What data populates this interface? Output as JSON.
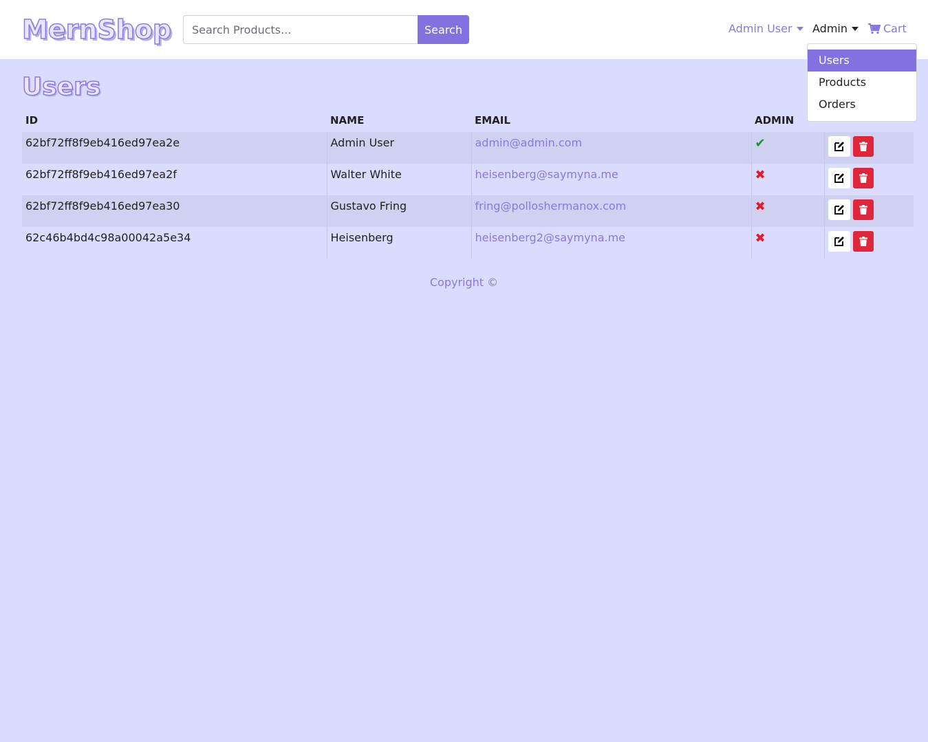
{
  "header": {
    "brand": "MernShop",
    "search_placeholder": "Search Products...",
    "search_button": "Search",
    "user_menu": "Admin User",
    "admin_menu": "Admin",
    "cart": "Cart"
  },
  "admin_dropdown": {
    "items": [
      {
        "label": "Users",
        "active": true
      },
      {
        "label": "Products",
        "active": false
      },
      {
        "label": "Orders",
        "active": false
      }
    ]
  },
  "page": {
    "title": "Users"
  },
  "table": {
    "columns": [
      "ID",
      "NAME",
      "EMAIL",
      "ADMIN",
      ""
    ],
    "rows": [
      {
        "id": "62bf72ff8f9eb416ed97ea2e",
        "name": "Admin User",
        "email": "admin@admin.com",
        "admin": true
      },
      {
        "id": "62bf72ff8f9eb416ed97ea2f",
        "name": "Walter White",
        "email": "heisenberg@saymyna.me",
        "admin": false
      },
      {
        "id": "62bf72ff8f9eb416ed97ea30",
        "name": "Gustavo Fring",
        "email": "fring@polloshermanox.com",
        "admin": false
      },
      {
        "id": "62c46b4bd4c98a00042a5e34",
        "name": "Heisenberg",
        "email": "heisenberg2@saymyna.me",
        "admin": false
      }
    ]
  },
  "footer": {
    "copyright": "Copyright ©"
  },
  "colors": {
    "accent": "#8471e0",
    "background": "#d9dcfc",
    "danger": "#e0263a",
    "success": "#119922"
  },
  "icons": {
    "admin_true": "check-icon",
    "admin_false": "x-icon",
    "edit": "edit-icon",
    "delete": "trash-icon",
    "cart": "cart-icon"
  }
}
